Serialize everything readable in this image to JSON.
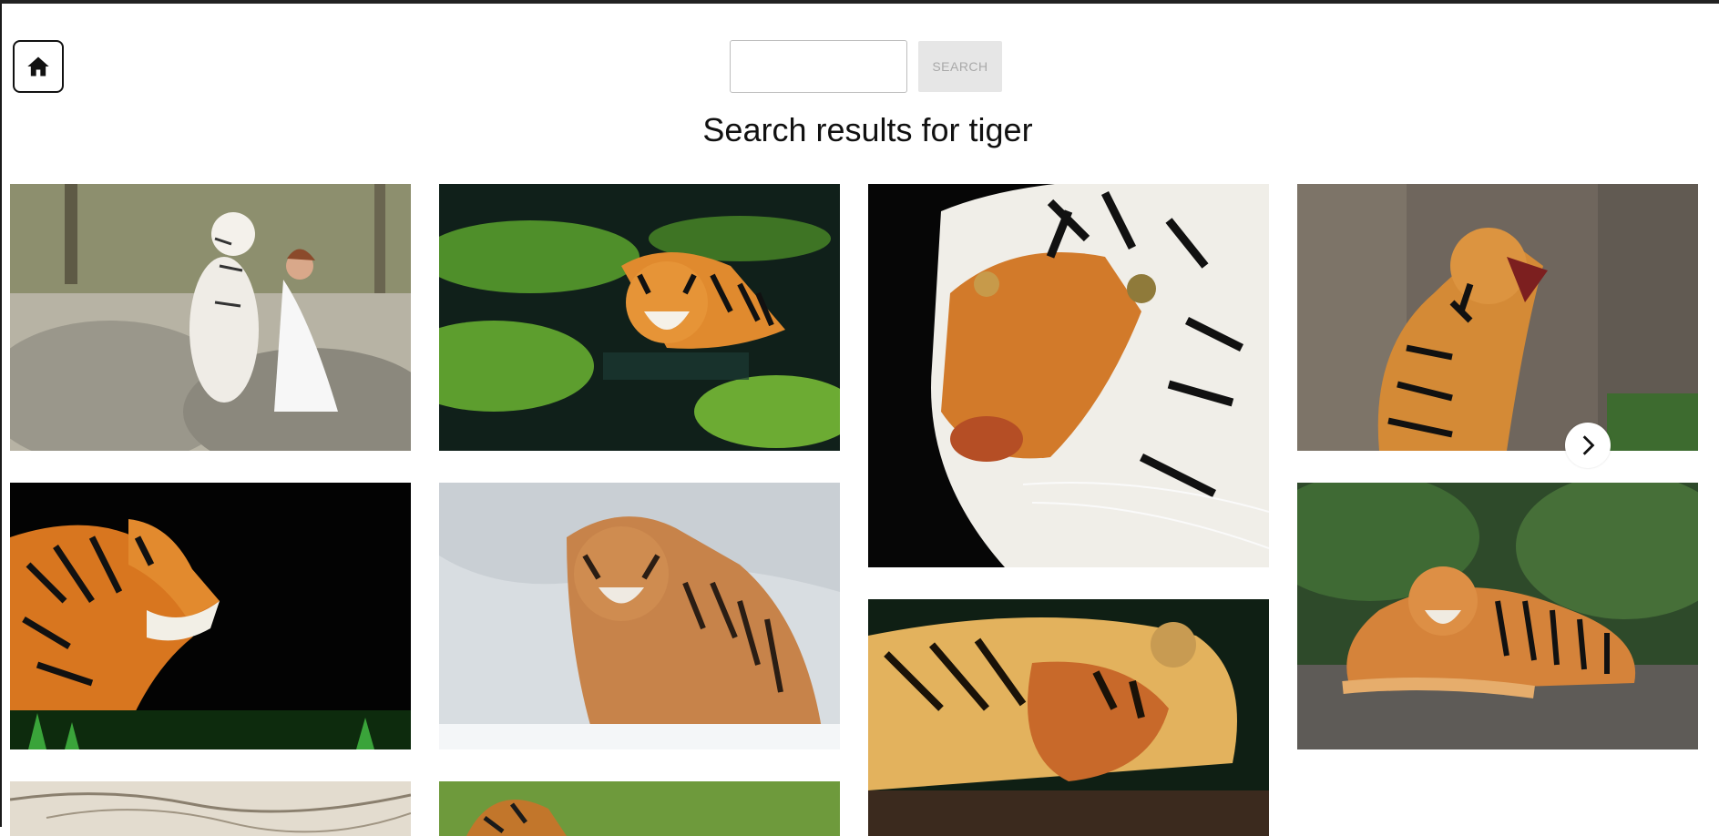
{
  "header": {
    "home_icon": "home-icon",
    "search": {
      "value": "",
      "placeholder": ""
    },
    "search_button_label": "SEARCH"
  },
  "results": {
    "title": "Search results for tiger"
  },
  "gallery": {
    "next_icon": "chevron-right-icon",
    "images": [
      {
        "subject": "white tiger with woman in white dress on rocks"
      },
      {
        "subject": "tiger wading in green algae water"
      },
      {
        "subject": "close-up tiger face on black"
      },
      {
        "subject": "roaring tiger by rock wall"
      },
      {
        "subject": "tiger profile on black with grass"
      },
      {
        "subject": "tiger walking in snow"
      },
      {
        "subject": "tiger lying down on dark ground"
      },
      {
        "subject": "tiger resting on stone ledge"
      },
      {
        "subject": "snowy branches"
      },
      {
        "subject": "tiger in green grass"
      }
    ]
  },
  "colors": {
    "accent_border": "#111111",
    "search_button_bg": "#e6e6e6",
    "search_button_text": "#a9a9a9"
  }
}
